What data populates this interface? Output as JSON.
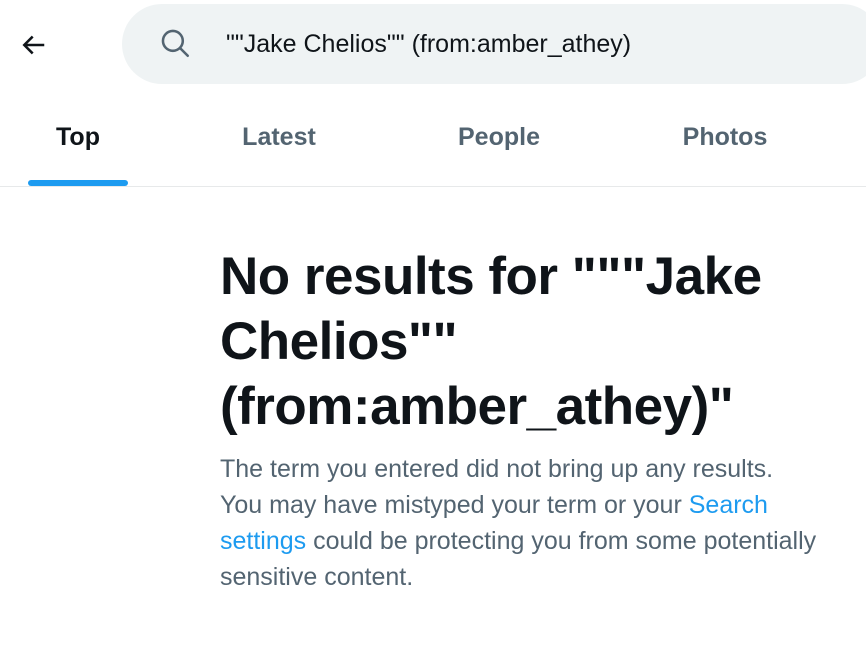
{
  "search": {
    "query": "\"\"Jake Chelios\"\" (from:amber_athey)",
    "icon": "search-icon"
  },
  "nav": {
    "back_icon": "back-arrow-icon"
  },
  "tabs": [
    {
      "label": "Top",
      "active": true
    },
    {
      "label": "Latest",
      "active": false
    },
    {
      "label": "People",
      "active": false
    },
    {
      "label": "Photos",
      "active": false
    }
  ],
  "empty_state": {
    "title": "No results for \"\"\"Jake Chelios\"\" (from:amber_athey)\"",
    "description_before_link": "The term you entered did not bring up any results. You may have mistyped your term or your ",
    "link_label": "Search settings",
    "description_after_link": " could be protecting you from some potentially sensitive content."
  },
  "colors": {
    "accent": "#1d9bf0",
    "text_primary": "#0f1419",
    "text_secondary": "#536471",
    "search_bg": "#eff3f4"
  }
}
